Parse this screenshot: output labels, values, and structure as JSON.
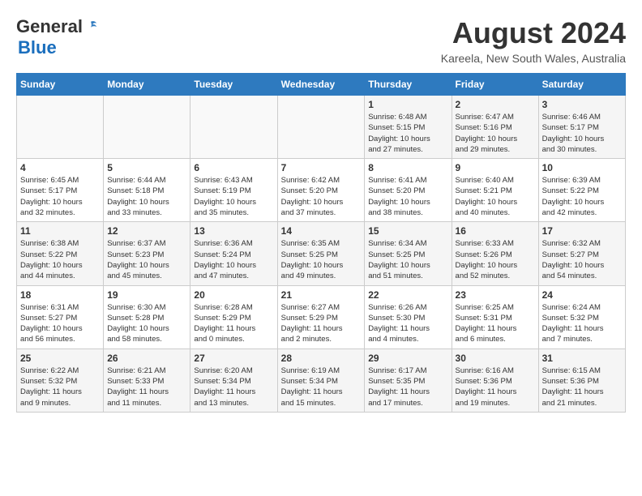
{
  "header": {
    "logo_general": "General",
    "logo_blue": "Blue",
    "month_year": "August 2024",
    "location": "Kareela, New South Wales, Australia"
  },
  "calendar": {
    "days_of_week": [
      "Sunday",
      "Monday",
      "Tuesday",
      "Wednesday",
      "Thursday",
      "Friday",
      "Saturday"
    ],
    "weeks": [
      [
        {
          "day": "",
          "info": ""
        },
        {
          "day": "",
          "info": ""
        },
        {
          "day": "",
          "info": ""
        },
        {
          "day": "",
          "info": ""
        },
        {
          "day": "1",
          "info": "Sunrise: 6:48 AM\nSunset: 5:15 PM\nDaylight: 10 hours\nand 27 minutes."
        },
        {
          "day": "2",
          "info": "Sunrise: 6:47 AM\nSunset: 5:16 PM\nDaylight: 10 hours\nand 29 minutes."
        },
        {
          "day": "3",
          "info": "Sunrise: 6:46 AM\nSunset: 5:17 PM\nDaylight: 10 hours\nand 30 minutes."
        }
      ],
      [
        {
          "day": "4",
          "info": "Sunrise: 6:45 AM\nSunset: 5:17 PM\nDaylight: 10 hours\nand 32 minutes."
        },
        {
          "day": "5",
          "info": "Sunrise: 6:44 AM\nSunset: 5:18 PM\nDaylight: 10 hours\nand 33 minutes."
        },
        {
          "day": "6",
          "info": "Sunrise: 6:43 AM\nSunset: 5:19 PM\nDaylight: 10 hours\nand 35 minutes."
        },
        {
          "day": "7",
          "info": "Sunrise: 6:42 AM\nSunset: 5:20 PM\nDaylight: 10 hours\nand 37 minutes."
        },
        {
          "day": "8",
          "info": "Sunrise: 6:41 AM\nSunset: 5:20 PM\nDaylight: 10 hours\nand 38 minutes."
        },
        {
          "day": "9",
          "info": "Sunrise: 6:40 AM\nSunset: 5:21 PM\nDaylight: 10 hours\nand 40 minutes."
        },
        {
          "day": "10",
          "info": "Sunrise: 6:39 AM\nSunset: 5:22 PM\nDaylight: 10 hours\nand 42 minutes."
        }
      ],
      [
        {
          "day": "11",
          "info": "Sunrise: 6:38 AM\nSunset: 5:22 PM\nDaylight: 10 hours\nand 44 minutes."
        },
        {
          "day": "12",
          "info": "Sunrise: 6:37 AM\nSunset: 5:23 PM\nDaylight: 10 hours\nand 45 minutes."
        },
        {
          "day": "13",
          "info": "Sunrise: 6:36 AM\nSunset: 5:24 PM\nDaylight: 10 hours\nand 47 minutes."
        },
        {
          "day": "14",
          "info": "Sunrise: 6:35 AM\nSunset: 5:25 PM\nDaylight: 10 hours\nand 49 minutes."
        },
        {
          "day": "15",
          "info": "Sunrise: 6:34 AM\nSunset: 5:25 PM\nDaylight: 10 hours\nand 51 minutes."
        },
        {
          "day": "16",
          "info": "Sunrise: 6:33 AM\nSunset: 5:26 PM\nDaylight: 10 hours\nand 52 minutes."
        },
        {
          "day": "17",
          "info": "Sunrise: 6:32 AM\nSunset: 5:27 PM\nDaylight: 10 hours\nand 54 minutes."
        }
      ],
      [
        {
          "day": "18",
          "info": "Sunrise: 6:31 AM\nSunset: 5:27 PM\nDaylight: 10 hours\nand 56 minutes."
        },
        {
          "day": "19",
          "info": "Sunrise: 6:30 AM\nSunset: 5:28 PM\nDaylight: 10 hours\nand 58 minutes."
        },
        {
          "day": "20",
          "info": "Sunrise: 6:28 AM\nSunset: 5:29 PM\nDaylight: 11 hours\nand 0 minutes."
        },
        {
          "day": "21",
          "info": "Sunrise: 6:27 AM\nSunset: 5:29 PM\nDaylight: 11 hours\nand 2 minutes."
        },
        {
          "day": "22",
          "info": "Sunrise: 6:26 AM\nSunset: 5:30 PM\nDaylight: 11 hours\nand 4 minutes."
        },
        {
          "day": "23",
          "info": "Sunrise: 6:25 AM\nSunset: 5:31 PM\nDaylight: 11 hours\nand 6 minutes."
        },
        {
          "day": "24",
          "info": "Sunrise: 6:24 AM\nSunset: 5:32 PM\nDaylight: 11 hours\nand 7 minutes."
        }
      ],
      [
        {
          "day": "25",
          "info": "Sunrise: 6:22 AM\nSunset: 5:32 PM\nDaylight: 11 hours\nand 9 minutes."
        },
        {
          "day": "26",
          "info": "Sunrise: 6:21 AM\nSunset: 5:33 PM\nDaylight: 11 hours\nand 11 minutes."
        },
        {
          "day": "27",
          "info": "Sunrise: 6:20 AM\nSunset: 5:34 PM\nDaylight: 11 hours\nand 13 minutes."
        },
        {
          "day": "28",
          "info": "Sunrise: 6:19 AM\nSunset: 5:34 PM\nDaylight: 11 hours\nand 15 minutes."
        },
        {
          "day": "29",
          "info": "Sunrise: 6:17 AM\nSunset: 5:35 PM\nDaylight: 11 hours\nand 17 minutes."
        },
        {
          "day": "30",
          "info": "Sunrise: 6:16 AM\nSunset: 5:36 PM\nDaylight: 11 hours\nand 19 minutes."
        },
        {
          "day": "31",
          "info": "Sunrise: 6:15 AM\nSunset: 5:36 PM\nDaylight: 11 hours\nand 21 minutes."
        }
      ]
    ]
  }
}
